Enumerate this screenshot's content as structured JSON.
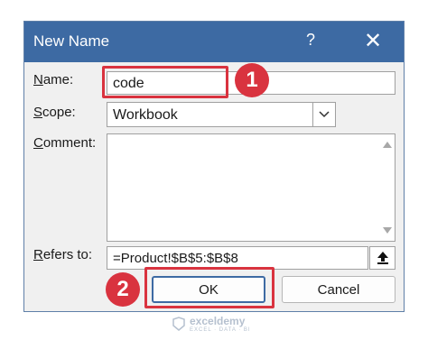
{
  "dialog": {
    "title": "New Name",
    "help_glyph": "?",
    "close_glyph": "✕"
  },
  "labels": {
    "name_first": "N",
    "name_rest": "ame:",
    "scope_first": "S",
    "scope_rest": "cope:",
    "comment_first": "C",
    "comment_rest": "omment:",
    "refers_first": "R",
    "refers_rest": "efers to:"
  },
  "fields": {
    "name_value": "code",
    "scope_value": "Workbook",
    "comment_value": "",
    "refers_value": "=Product!$B$5:$B$8"
  },
  "buttons": {
    "ok": "OK",
    "cancel": "Cancel"
  },
  "annotations": {
    "step1": "1",
    "step2": "2"
  },
  "watermark": {
    "name": "exceldemy",
    "tagline": "EXCEL · DATA · BI"
  },
  "colors": {
    "titlebar": "#3d6aa3",
    "highlight": "#d9333f"
  }
}
